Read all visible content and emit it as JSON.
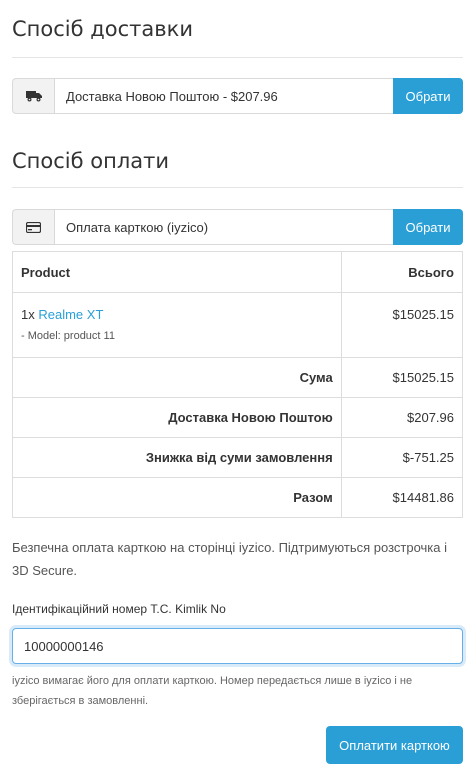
{
  "delivery": {
    "heading": "Спосіб доставки",
    "icon": "truck-icon",
    "selected": "Доставка Новою Поштою - $207.96",
    "button": "Обрати"
  },
  "payment": {
    "heading": "Спосіб оплати",
    "icon": "credit-card-icon",
    "selected": "Оплата карткою (iyzico)",
    "button": "Обрати"
  },
  "table": {
    "headers": [
      "Product",
      "Всього"
    ],
    "product": {
      "qty": "1x",
      "name": "Realme XT",
      "option": "- Model: product 11",
      "price": "$15025.15"
    },
    "totals": [
      {
        "label": "Сума",
        "value": "$15025.15"
      },
      {
        "label": "Доставка Новою Поштою",
        "value": "$207.96"
      },
      {
        "label": "Знижка від суми замовлення",
        "value": "$-751.25"
      },
      {
        "label": "Разом",
        "value": "$14481.86"
      }
    ]
  },
  "iyzico": {
    "description": "Безпечна оплата карткою на сторінці iyzico. Підтримуються розстрочка і 3D Secure.",
    "id_label": "Ідентифікаційний номер T.C. Kimlik No",
    "id_value": "10000000146",
    "help": "iyzico вимагає його для оплати карткою. Номер передається лише в iyzico і не зберігається в замовленні.",
    "pay_button": "Оплатити карткою"
  },
  "colors": {
    "accent": "#2a9fd6",
    "link": "#2a9fd6"
  }
}
